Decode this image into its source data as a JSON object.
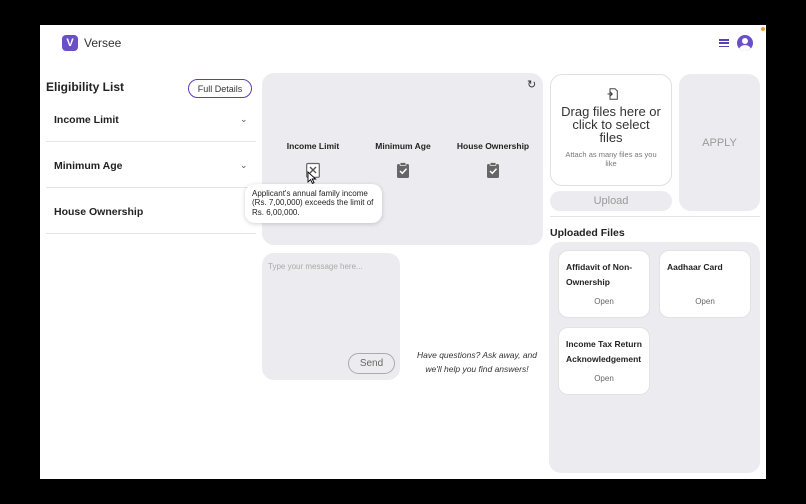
{
  "header": {
    "app_name": "Versee",
    "logo_letter": "V",
    "menu_icon": "hamburger-menu-icon",
    "avatar_icon": "user-avatar-icon"
  },
  "eligibility": {
    "title": "Eligibility List",
    "full_details_label": "Full Details",
    "items": [
      {
        "label": "Income Limit",
        "chevron": "⌄"
      },
      {
        "label": "Minimum Age",
        "chevron": "⌄"
      },
      {
        "label": "House Ownership",
        "chevron": ""
      }
    ]
  },
  "status": {
    "refresh_icon": "↻",
    "criteria": [
      {
        "label": "Income Limit",
        "state": "failed"
      },
      {
        "label": "Minimum Age",
        "state": "passed"
      },
      {
        "label": "House Ownership",
        "state": "passed"
      }
    ],
    "tooltip": "Applicant's annual family income (Rs. 7,00,000) exceeds the limit of Rs. 6,00,000."
  },
  "chat": {
    "placeholder": "Type your message here...",
    "send_label": "Send",
    "help_line1": "Have questions? Ask away, and",
    "help_line2": "we'll help you find answers!"
  },
  "upload": {
    "drop_title": "Drag files here or click to select files",
    "drop_sub": "Attach as many files as you like",
    "upload_label": "Upload",
    "apply_label": "APPLY"
  },
  "uploaded": {
    "title": "Uploaded Files",
    "files": [
      {
        "name": "Affidavit of Non-Ownership",
        "open": "Open"
      },
      {
        "name": "Aadhaar Card",
        "open": "Open"
      },
      {
        "name": "Income Tax Return Acknowledgement",
        "open": "Open"
      }
    ]
  },
  "colors": {
    "accent": "#6a4fc9",
    "panel": "#ececf0",
    "background": "#000000"
  }
}
